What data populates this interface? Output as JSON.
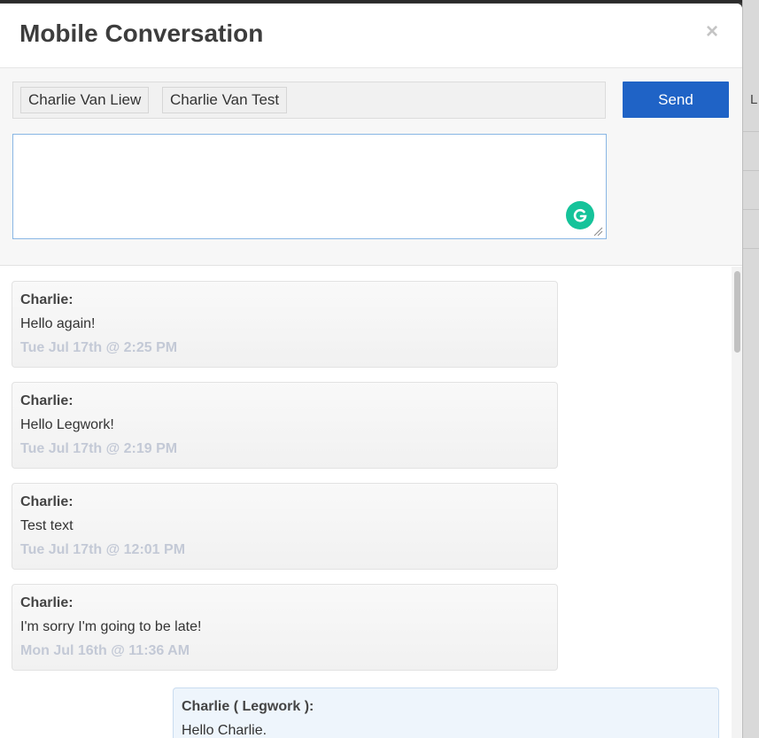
{
  "dialog": {
    "title": "Mobile Conversation",
    "close_icon": "close-icon",
    "close_glyph": "×"
  },
  "compose": {
    "recipients": [
      "Charlie Van Liew",
      "Charlie Van Test"
    ],
    "send_label": "Send",
    "message_value": "",
    "grammarly_icon": "grammarly-icon"
  },
  "messages": [
    {
      "sender": "Charlie:",
      "body": "Hello again!",
      "time": "Tue Jul 17th @ 2:25 PM",
      "direction": "incoming"
    },
    {
      "sender": "Charlie:",
      "body": "Hello Legwork!",
      "time": "Tue Jul 17th @ 2:19 PM",
      "direction": "incoming"
    },
    {
      "sender": "Charlie:",
      "body": "Test text",
      "time": "Tue Jul 17th @ 12:01 PM",
      "direction": "incoming"
    },
    {
      "sender": "Charlie:",
      "body": "I'm sorry I'm going to be late!",
      "time": "Mon Jul 16th @ 11:36 AM",
      "direction": "incoming"
    },
    {
      "sender": "Charlie ( Legwork ):",
      "body": "Hello Charlie.",
      "time": "",
      "direction": "outgoing"
    }
  ],
  "background": {
    "letter": "L"
  },
  "colors": {
    "send_button": "#1f63c6",
    "timestamp": "#c3c9d6",
    "grammarly": "#15c39a"
  }
}
